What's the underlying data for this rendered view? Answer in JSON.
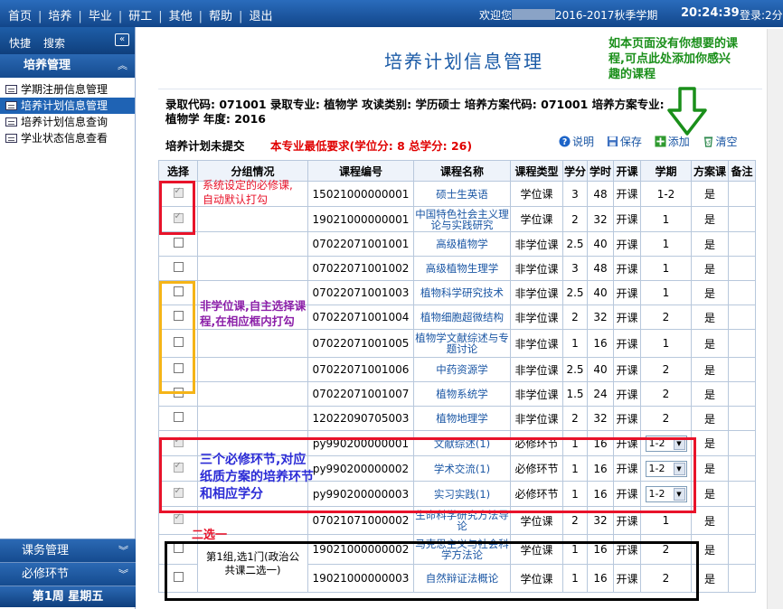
{
  "topbar": {
    "nav": [
      "首页",
      "培养",
      "毕业",
      "研工",
      "其他",
      "帮助",
      "退出"
    ],
    "welcome_prefix": "欢迎您",
    "term": "2016-2017秋季学期",
    "clock": "20:24:39",
    "login": "登录:2分"
  },
  "sidebar": {
    "quick": "快捷",
    "search": "搜索",
    "collapse_icon": "double-chevron-left-icon",
    "section": "培养管理",
    "items": [
      {
        "label": "学期注册信息管理",
        "active": false
      },
      {
        "label": "培养计划信息管理",
        "active": true
      },
      {
        "label": "培养计划信息查询",
        "active": false
      },
      {
        "label": "学业状态信息查看",
        "active": false
      }
    ],
    "bottom": [
      {
        "label": "课务管理"
      },
      {
        "label": "必修环节"
      }
    ],
    "week": "第1周 星期五"
  },
  "page": {
    "title": "培养计划信息管理",
    "info": {
      "line1": "录取代码: 071001    录取专业: 植物学    攻读类别: 学历硕士    培养方案代码: 071001    培养方案专业:",
      "line2": "植物学    年度: 2016",
      "status": "培养计划未提交",
      "requirement": "本专业最低要求(学位分: 8 总学分: 26)"
    },
    "actions": [
      {
        "label": "说明",
        "icon": "help-icon"
      },
      {
        "label": "保存",
        "icon": "save-icon"
      },
      {
        "label": "添加",
        "icon": "add-icon"
      },
      {
        "label": "清空",
        "icon": "clear-icon"
      }
    ]
  },
  "table": {
    "headers": [
      "选择",
      "分组情况",
      "课程编号",
      "课程名称",
      "课程类型",
      "学分",
      "学时",
      "开课",
      "学期",
      "方案课",
      "备注"
    ],
    "rows": [
      {
        "checked": true,
        "group": "",
        "code": "15021000000001",
        "name": "硕士生英语",
        "type": "学位课",
        "credit": "3",
        "hours": "48",
        "open": "开课",
        "term": "1-2",
        "plan": "是",
        "note": ""
      },
      {
        "checked": true,
        "group": "",
        "code": "19021000000001",
        "name": "中国特色社会主义理论与实践研究",
        "type": "学位课",
        "credit": "2",
        "hours": "32",
        "open": "开课",
        "term": "1",
        "plan": "是",
        "note": ""
      },
      {
        "checked": false,
        "group": "",
        "code": "07022071001001",
        "name": "高级植物学",
        "type": "非学位课",
        "credit": "2.5",
        "hours": "40",
        "open": "开课",
        "term": "1",
        "plan": "是",
        "note": ""
      },
      {
        "checked": false,
        "group": "",
        "code": "07022071001002",
        "name": "高级植物生理学",
        "type": "非学位课",
        "credit": "3",
        "hours": "48",
        "open": "开课",
        "term": "1",
        "plan": "是",
        "note": ""
      },
      {
        "checked": false,
        "group": "",
        "code": "07022071001003",
        "name": "植物科学研究技术",
        "type": "非学位课",
        "credit": "2.5",
        "hours": "40",
        "open": "开课",
        "term": "1",
        "plan": "是",
        "note": ""
      },
      {
        "checked": false,
        "group": "",
        "code": "07022071001004",
        "name": "植物细胞超微结构",
        "type": "非学位课",
        "credit": "2",
        "hours": "32",
        "open": "开课",
        "term": "2",
        "plan": "是",
        "note": ""
      },
      {
        "checked": false,
        "group": "",
        "code": "07022071001005",
        "name": "植物学文献综述与专题讨论",
        "type": "非学位课",
        "credit": "1",
        "hours": "16",
        "open": "开课",
        "term": "1",
        "plan": "是",
        "note": ""
      },
      {
        "checked": false,
        "group": "",
        "code": "07022071001006",
        "name": "中药资源学",
        "type": "非学位课",
        "credit": "2.5",
        "hours": "40",
        "open": "开课",
        "term": "2",
        "plan": "是",
        "note": ""
      },
      {
        "checked": false,
        "group": "",
        "code": "07022071001007",
        "name": "植物系统学",
        "type": "非学位课",
        "credit": "1.5",
        "hours": "24",
        "open": "开课",
        "term": "2",
        "plan": "是",
        "note": ""
      },
      {
        "checked": false,
        "group": "",
        "code": "12022090705003",
        "name": "植物地理学",
        "type": "非学位课",
        "credit": "2",
        "hours": "32",
        "open": "开课",
        "term": "2",
        "plan": "是",
        "note": ""
      },
      {
        "checked": true,
        "group": "",
        "code": "py990200000001",
        "name": "文献综述(1)",
        "type": "必修环节",
        "credit": "1",
        "hours": "16",
        "open": "开课",
        "term": "1-2",
        "select": true,
        "plan": "是",
        "note": ""
      },
      {
        "checked": true,
        "group": "",
        "code": "py990200000002",
        "name": "学术交流(1)",
        "type": "必修环节",
        "credit": "1",
        "hours": "16",
        "open": "开课",
        "term": "1-2",
        "select": true,
        "plan": "是",
        "note": ""
      },
      {
        "checked": true,
        "group": "",
        "code": "py990200000003",
        "name": "实习实践(1)",
        "type": "必修环节",
        "credit": "1",
        "hours": "16",
        "open": "开课",
        "term": "1-2",
        "select": true,
        "plan": "是",
        "note": ""
      },
      {
        "checked": true,
        "group": "",
        "code": "07021071000002",
        "name": "生命科学研究方法导论",
        "type": "学位课",
        "credit": "2",
        "hours": "32",
        "open": "开课",
        "term": "1",
        "plan": "是",
        "note": ""
      },
      {
        "checked": false,
        "group": "第1组,选1门(政治公共课二选一)",
        "code": "19021000000002",
        "name": "马克思主义与社会科学方法论",
        "type": "学位课",
        "credit": "1",
        "hours": "16",
        "open": "开课",
        "term": "2",
        "plan": "是",
        "note": ""
      },
      {
        "checked": false,
        "group": "",
        "code": "19021000000003",
        "name": "自然辩证法概论",
        "type": "学位课",
        "credit": "1",
        "hours": "16",
        "open": "开课",
        "term": "2",
        "plan": "是",
        "note": ""
      }
    ]
  },
  "annotations": {
    "required_note": "系统设定的必修课,\n自动默认打勾",
    "elective_note": "非学位课,自主选择课\n程,在相应框内打勾",
    "links_note": "三个必修环节,对应\n纸质方案的培养环节\n和相应学分",
    "choose_one": "二选一",
    "add_note": "如本页面没有你想要的课\n程,可点此处添加你感兴\n趣的课程",
    "colors": {
      "red": "#e8132a",
      "yellow": "#f5b417",
      "black": "#000000",
      "green": "#1a8f1a",
      "purple": "#8b1fa8",
      "blue": "#2b2bd6"
    }
  }
}
